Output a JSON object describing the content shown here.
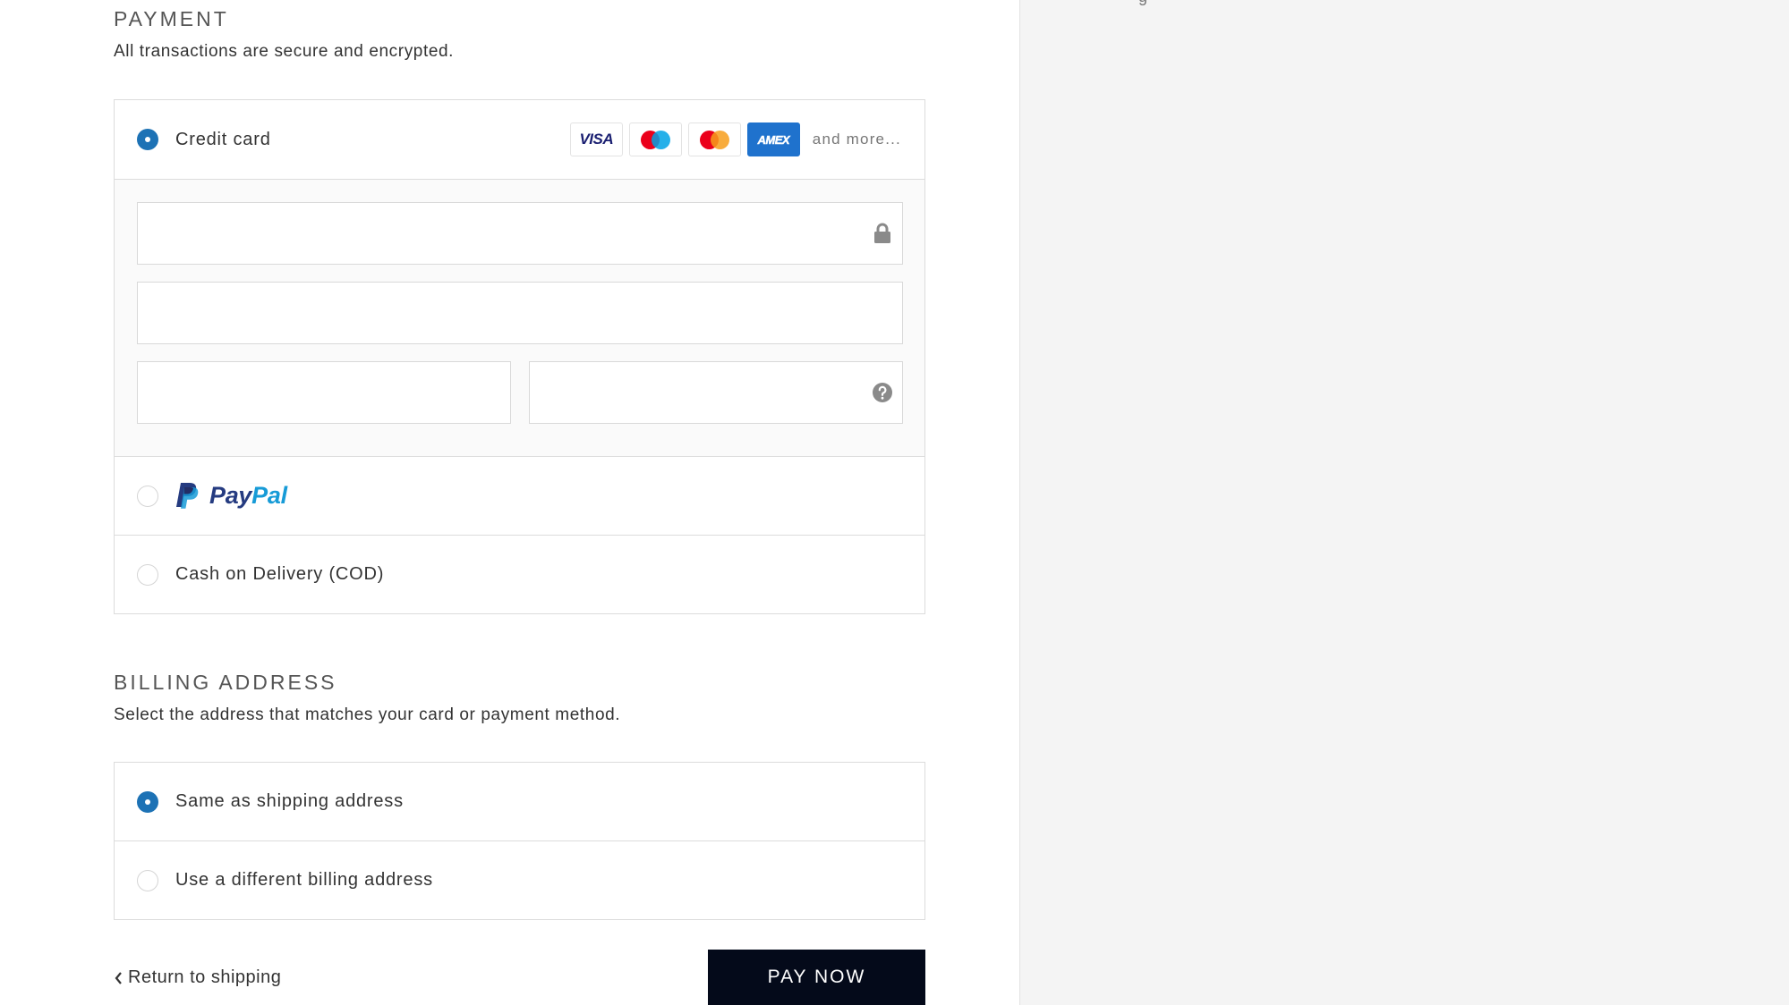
{
  "payment": {
    "title": "PAYMENT",
    "subtitle": "All transactions are secure and encrypted.",
    "methods": [
      {
        "label": "Credit card",
        "selected": true
      },
      {
        "label": "PayPal",
        "selected": false
      },
      {
        "label": "Cash on Delivery (COD)",
        "selected": false
      }
    ],
    "card_brands": [
      {
        "name": "VISA",
        "icon": "visa-icon"
      },
      {
        "name": "Maestro",
        "icon": "maestro-icon"
      },
      {
        "name": "Mastercard",
        "icon": "mastercard-icon"
      },
      {
        "name": "AMEX",
        "icon": "amex-icon"
      }
    ],
    "more_label": "and more...",
    "paypal": {
      "word_part1": "Pay",
      "word_part2": "Pal"
    },
    "fields": {
      "card_number": {
        "value": "",
        "placeholder": "",
        "icon": "lock-icon"
      },
      "name_on_card": {
        "value": "",
        "placeholder": ""
      },
      "expiration": {
        "value": "",
        "placeholder": ""
      },
      "security_code": {
        "value": "",
        "placeholder": "",
        "icon": "help-icon"
      }
    }
  },
  "billing": {
    "title": "BILLING ADDRESS",
    "subtitle": "Select the address that matches your card or payment method.",
    "options": [
      {
        "label": "Same as shipping address",
        "selected": true
      },
      {
        "label": "Use a different billing address",
        "selected": false
      }
    ]
  },
  "footer": {
    "back_label": "Return to shipping",
    "pay_label": "PAY NOW"
  },
  "sidebar": {
    "cut_off_glyph": "g"
  },
  "colors": {
    "accent": "#1d72b5",
    "button_bg": "#040a1a",
    "sidebar_bg": "#f4f4f4"
  }
}
